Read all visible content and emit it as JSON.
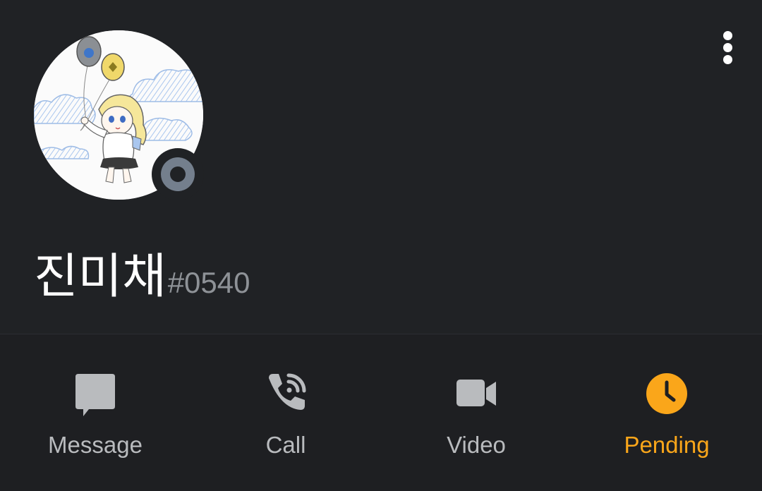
{
  "profile": {
    "username": "진미채",
    "discriminator": "#0540",
    "status": "offline"
  },
  "actions": [
    {
      "label": "Message",
      "icon": "message-icon"
    },
    {
      "label": "Call",
      "icon": "call-icon"
    },
    {
      "label": "Video",
      "icon": "video-icon"
    },
    {
      "label": "Pending",
      "icon": "clock-icon",
      "color": "#faa61a"
    }
  ],
  "colors": {
    "background": "#202225",
    "bottom_bar": "#1e1f22",
    "label": "#b9bbbe",
    "discriminator": "#8e9297",
    "pending": "#faa61a",
    "status_offline": "#747f8d"
  },
  "menu": {
    "icon": "more-vertical-icon"
  }
}
